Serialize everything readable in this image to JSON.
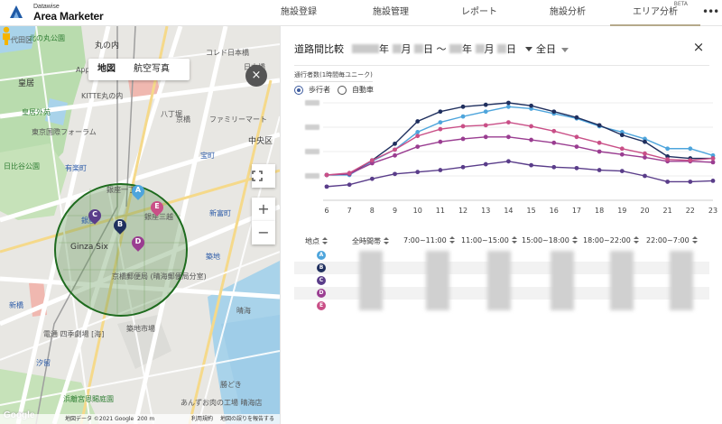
{
  "header": {
    "logo_small": "Datawise",
    "logo_big": "Area Marketer",
    "nav": [
      {
        "label": "施設登録",
        "active": false
      },
      {
        "label": "施設管理",
        "active": false
      },
      {
        "label": "レポート",
        "active": false
      },
      {
        "label": "施設分析",
        "active": false
      },
      {
        "label": "エリア分析",
        "active": true,
        "badge": "BETA"
      }
    ],
    "more_icon": "more-horiz-icon"
  },
  "map": {
    "toggle_map": "地図",
    "toggle_aerial": "航空写真",
    "close": "×",
    "zoom_in": "+",
    "zoom_out": "−",
    "fullscreen_icon": "fullscreen-icon",
    "labels": [
      "千代田区",
      "北の丸公園",
      "丸の内",
      "東京",
      "皇居",
      "皇居外苑",
      "Apple 丸の内",
      "KITTE丸の内",
      "東京国際フォーラム",
      "日比谷公園",
      "有楽町",
      "銀座一丁目",
      "銀座",
      "銀座三越",
      "Ginza Six",
      "京橋",
      "宝町",
      "八丁堀",
      "新富町",
      "築地",
      "勝どき",
      "汐留",
      "新橋",
      "浜離宮恩賜庭園",
      "築地市場",
      "晴海",
      "日本橋",
      "コレド日本橋",
      "ファミリーマート",
      "中央区",
      "電通 四季劇場 [海]",
      "京橋郵便局 (晴海郵便局分室)",
      "あんずお肉の工場 晴海店"
    ],
    "google": "Google",
    "footer": {
      "map_data": "地図データ ©2021 Google",
      "scale": "200 m",
      "terms": "利用規約",
      "report": "地図の誤りを報告する"
    }
  },
  "panel": {
    "title": "道路間比較",
    "date_start": {
      "year_suffix": "年",
      "month_suffix": "月",
      "day_suffix": "日"
    },
    "date_sep": "〜",
    "date_end": {
      "year_suffix": "年",
      "month_suffix": "月",
      "day_suffix": "日"
    },
    "day_select": "全日",
    "close": "×",
    "sub_label": "通行者数(1時間毎ユニーク)",
    "radio_pedestrian": "歩行者",
    "radio_vehicle": "自動車"
  },
  "chart_data": {
    "type": "line",
    "x": [
      6,
      7,
      8,
      9,
      10,
      11,
      12,
      13,
      14,
      15,
      16,
      17,
      18,
      19,
      20,
      21,
      22,
      23
    ],
    "title": "",
    "xlabel": "",
    "ylabel": "",
    "grid": true,
    "series": [
      {
        "name": "A",
        "color": "#4ea5dc",
        "values": [
          0.26,
          0.26,
          0.4,
          0.52,
          0.7,
          0.8,
          0.86,
          0.91,
          0.96,
          0.94,
          0.89,
          0.84,
          0.76,
          0.7,
          0.63,
          0.53,
          0.53,
          0.46
        ]
      },
      {
        "name": "B",
        "color": "#1f2f5e",
        "values": [
          0.26,
          0.27,
          0.41,
          0.58,
          0.81,
          0.91,
          0.96,
          0.98,
          1.0,
          0.97,
          0.91,
          0.85,
          0.77,
          0.67,
          0.6,
          0.45,
          0.43,
          0.43
        ]
      },
      {
        "name": "C",
        "color": "#5a3d8a",
        "values": [
          0.14,
          0.16,
          0.22,
          0.27,
          0.29,
          0.31,
          0.34,
          0.37,
          0.4,
          0.36,
          0.34,
          0.33,
          0.31,
          0.3,
          0.25,
          0.19,
          0.19,
          0.2
        ]
      },
      {
        "name": "D",
        "color": "#9a3d91",
        "values": [
          0.26,
          0.27,
          0.38,
          0.46,
          0.55,
          0.6,
          0.63,
          0.65,
          0.65,
          0.62,
          0.59,
          0.55,
          0.5,
          0.47,
          0.44,
          0.4,
          0.4,
          0.39
        ]
      },
      {
        "name": "E",
        "color": "#c94f87",
        "values": [
          0.26,
          0.28,
          0.41,
          0.52,
          0.66,
          0.73,
          0.76,
          0.77,
          0.8,
          0.76,
          0.71,
          0.65,
          0.59,
          0.53,
          0.48,
          0.42,
          0.41,
          0.43
        ]
      }
    ]
  },
  "table": {
    "headers": [
      "地点",
      "全時間帯",
      "7:00~11:00",
      "11:00~15:00",
      "15:00~18:00",
      "18:00~22:00",
      "22:00~7:00"
    ],
    "rows": [
      {
        "label": "A",
        "color": "#4ea5dc"
      },
      {
        "label": "B",
        "color": "#1f2f5e"
      },
      {
        "label": "C",
        "color": "#5a3d8a"
      },
      {
        "label": "D",
        "color": "#9a3d91"
      },
      {
        "label": "E",
        "color": "#c94f87"
      }
    ]
  }
}
